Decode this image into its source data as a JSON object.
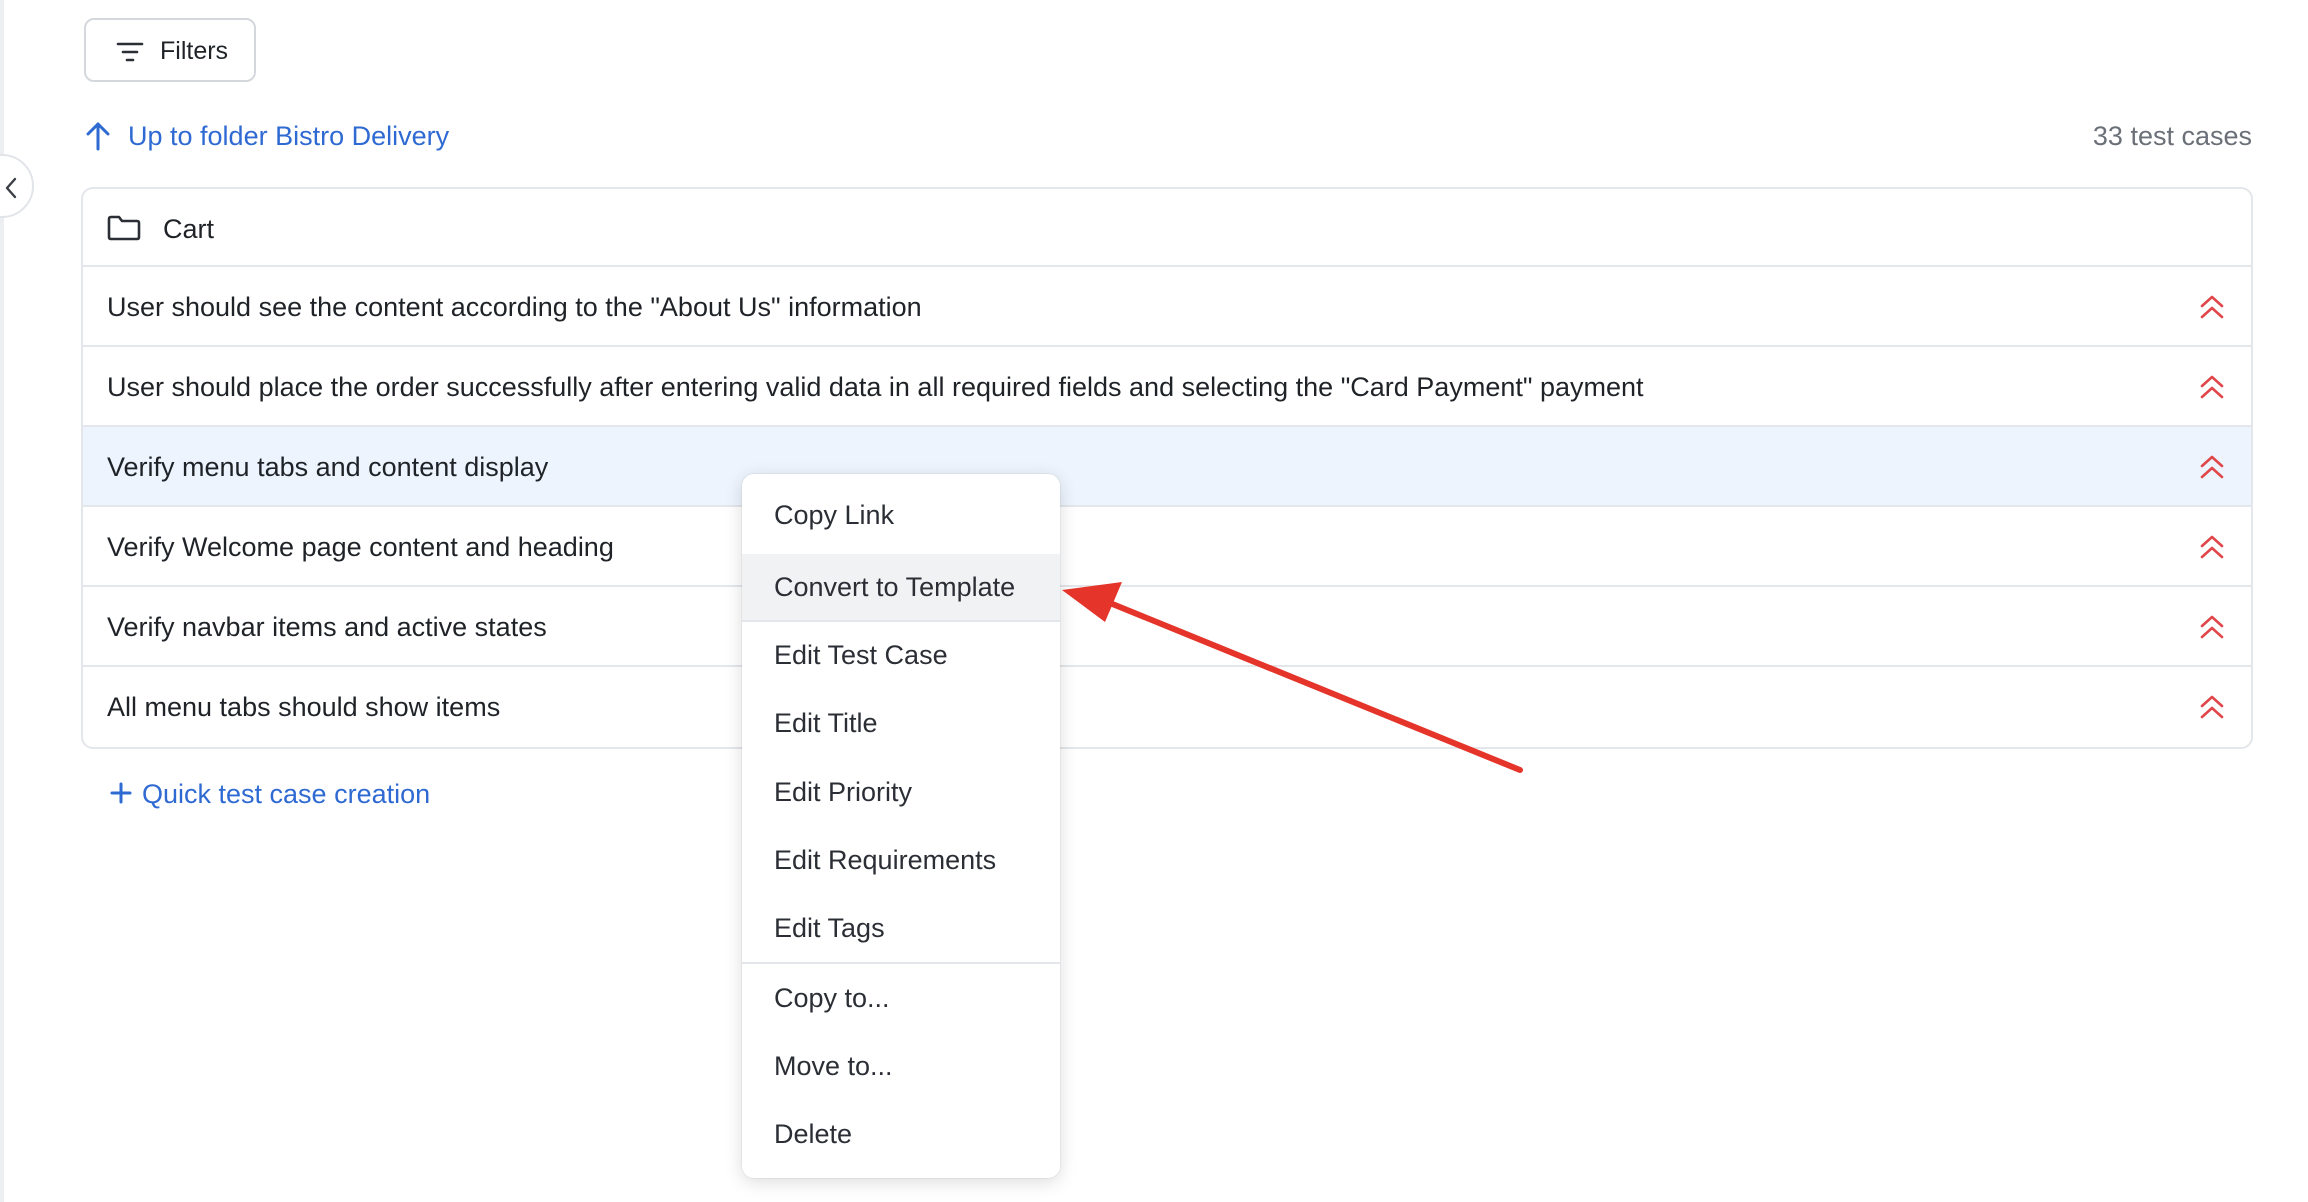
{
  "toolbar": {
    "filters_label": "Filters",
    "filters_icon": "filter-lines-icon"
  },
  "navigation": {
    "up_link_label": "Up to folder Bistro Delivery",
    "up_icon": "arrow-up-icon",
    "case_count": "33 test cases"
  },
  "list": {
    "folder_name": "Cart",
    "folder_icon": "folder-icon",
    "cases": [
      {
        "title": "User should see the content according to the \"About Us\" information",
        "priority_icon": "priority-high-icon"
      },
      {
        "title": "User should place the order successfully after entering valid data in all required fields and selecting the \"Card Payment\" payment",
        "priority_icon": "priority-high-icon"
      },
      {
        "title": "Verify menu tabs and content display",
        "priority_icon": "priority-high-icon",
        "selected": true
      },
      {
        "title": "Verify Welcome page content and heading",
        "priority_icon": "priority-high-icon"
      },
      {
        "title": "Verify navbar items and active states",
        "priority_icon": "priority-high-icon"
      },
      {
        "title": "All menu tabs should show items",
        "priority_icon": "priority-high-icon"
      }
    ]
  },
  "quick_add": {
    "label": "Quick test case creation",
    "icon": "plus-icon"
  },
  "context_menu": {
    "items": [
      {
        "label": "Copy Link"
      },
      {
        "label": "Convert to Template",
        "hovered": true
      },
      {
        "label": "Edit Test Case"
      },
      {
        "label": "Edit Title"
      },
      {
        "label": "Edit Priority"
      },
      {
        "label": "Edit Requirements"
      },
      {
        "label": "Edit Tags"
      },
      {
        "label": "Copy to..."
      },
      {
        "label": "Move to..."
      },
      {
        "label": "Delete"
      }
    ]
  },
  "colors": {
    "link": "#2f6ad3",
    "priority": "#e0474a",
    "selected_row": "#edf4fd",
    "annotation_arrow": "#e5352b"
  }
}
